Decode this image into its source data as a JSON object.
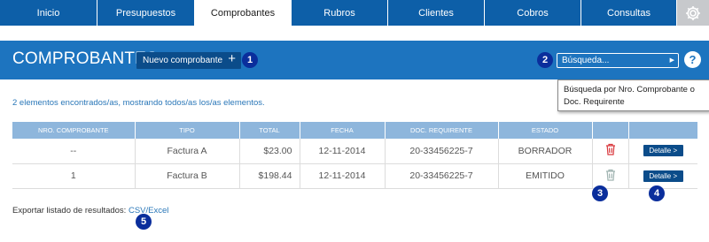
{
  "nav": {
    "tabs": [
      {
        "label": "Inicio"
      },
      {
        "label": "Presupuestos"
      },
      {
        "label": "Comprobantes"
      },
      {
        "label": "Rubros"
      },
      {
        "label": "Clientes"
      },
      {
        "label": "Cobros"
      },
      {
        "label": "Consultas"
      }
    ],
    "settings_icon": "gear-icon"
  },
  "header": {
    "title": "COMPROBANTES",
    "new_button": "Nuevo comprobante",
    "new_button_icon": "+",
    "search_placeholder": "Búsqueda...",
    "help_label": "?",
    "tooltip": "Búsqueda por Nro. Comprobante o Doc. Requirente"
  },
  "results_text": "2 elementos encontrados/as, mostrando todos/as los/as elementos.",
  "table": {
    "columns": [
      "NRO. COMPROBANTE",
      "TIPO",
      "TOTAL",
      "FECHA",
      "DOC. REQUIRENTE",
      "ESTADO",
      "",
      ""
    ],
    "rows": [
      {
        "nro": "--",
        "tipo": "Factura A",
        "total": "$23.00",
        "fecha": "12-11-2014",
        "doc": "20-33456225-7",
        "estado": "BORRADOR",
        "detalle": "Detalle",
        "trash_color": "#d9393e"
      },
      {
        "nro": "1",
        "tipo": "Factura B",
        "total": "$198.44",
        "fecha": "12-11-2014",
        "doc": "20-33456225-7",
        "estado": "EMITIDO",
        "detalle": "Detalle",
        "trash_color": "#9fb3b0"
      }
    ]
  },
  "export": {
    "label": "Exportar listado de resultados:",
    "link": "CSV/Excel"
  },
  "badges": [
    "1",
    "2",
    "3",
    "4",
    "5"
  ],
  "colors": {
    "nav": "#0d5fa8",
    "header": "#1d74bf",
    "table_header": "#8eb6dc",
    "button": "#0b4c8a",
    "badge": "#0a2e9c",
    "link": "#2a77b8"
  }
}
